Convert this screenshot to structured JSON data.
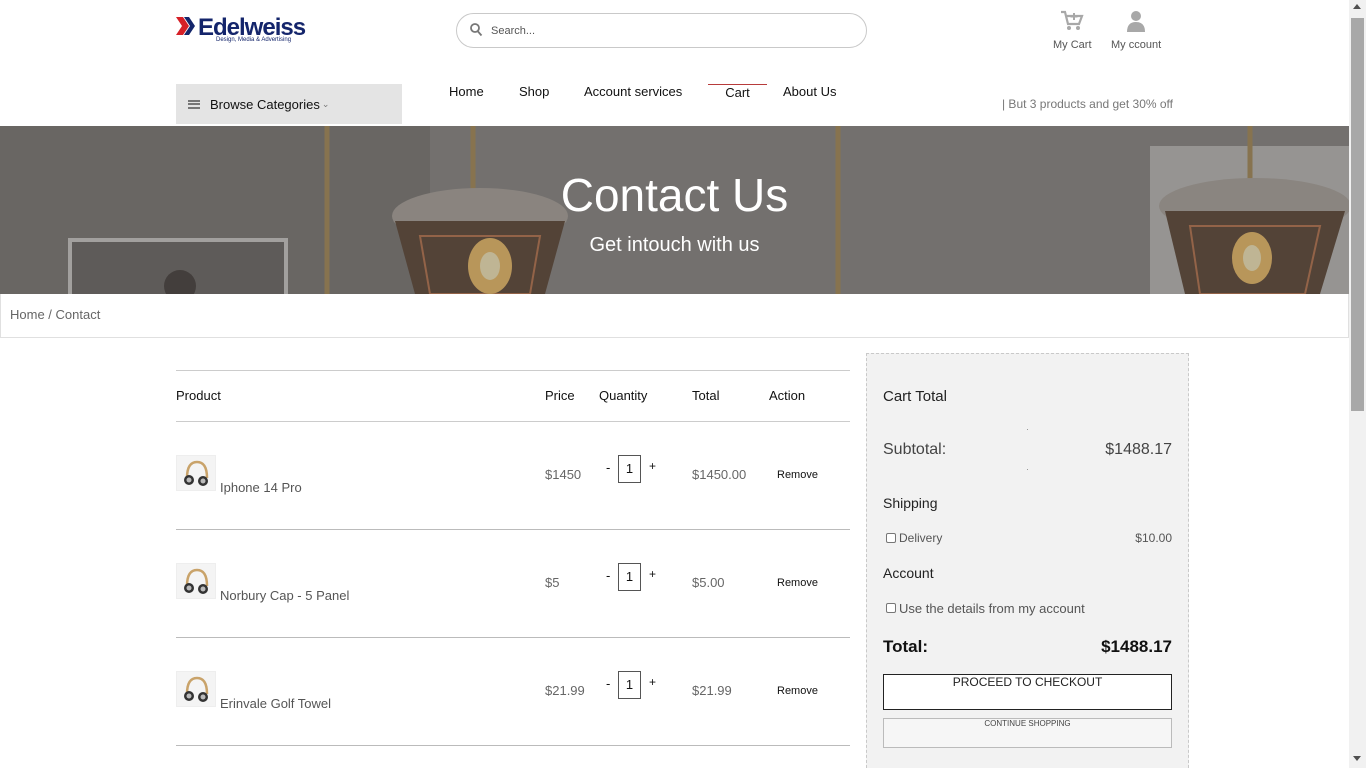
{
  "brand": {
    "name": "Edelweiss",
    "tagline": "Design, Media & Advertising"
  },
  "search": {
    "placeholder": "Search..."
  },
  "header": {
    "cart_label": "My Cart",
    "account_label": "My ccount"
  },
  "nav": {
    "browse_label": "Browse Categories",
    "items": [
      {
        "label": "Home"
      },
      {
        "label": "Shop"
      },
      {
        "label": "Account services"
      },
      {
        "label": "Cart"
      },
      {
        "label": "About Us"
      }
    ],
    "promo": "| But 3 products and get 30% off"
  },
  "hero": {
    "title": "Contact Us",
    "subtitle": "Get intouch with us"
  },
  "breadcrumb": {
    "home": "Home",
    "separator": " / ",
    "current": "Contact"
  },
  "cart": {
    "headers": {
      "product": "Product",
      "price": "Price",
      "quantity": "Quantity",
      "total": "Total",
      "action": "Action"
    },
    "minus": "-",
    "plus": "+",
    "items": [
      {
        "name": "Iphone 14 Pro",
        "price": "$1450",
        "quantity": "1",
        "total": "$1450.00",
        "action": "Remove"
      },
      {
        "name": "Norbury Cap - 5 Panel",
        "price": "$5",
        "quantity": "1",
        "total": "$5.00",
        "action": "Remove"
      },
      {
        "name": "Erinvale Golf Towel",
        "price": "$21.99",
        "quantity": "1",
        "total": "$21.99",
        "action": "Remove"
      }
    ]
  },
  "summary": {
    "title": "Cart Total",
    "subtotal_label": "Subtotal:",
    "subtotal_value": "$1488.17",
    "shipping_heading": "Shipping",
    "delivery_label": "Delivery",
    "delivery_value": "$10.00",
    "account_heading": "Account",
    "account_option": "Use the details from my account",
    "total_label": "Total:",
    "total_value": "$1488.17",
    "checkout_label": "PROCEED TO CHECKOUT",
    "continue_label": "CONTINUE SHOPPING"
  },
  "colors": {
    "brand_navy": "#14256b",
    "brand_red": "#d62027",
    "active_nav": "#b73b3b"
  }
}
